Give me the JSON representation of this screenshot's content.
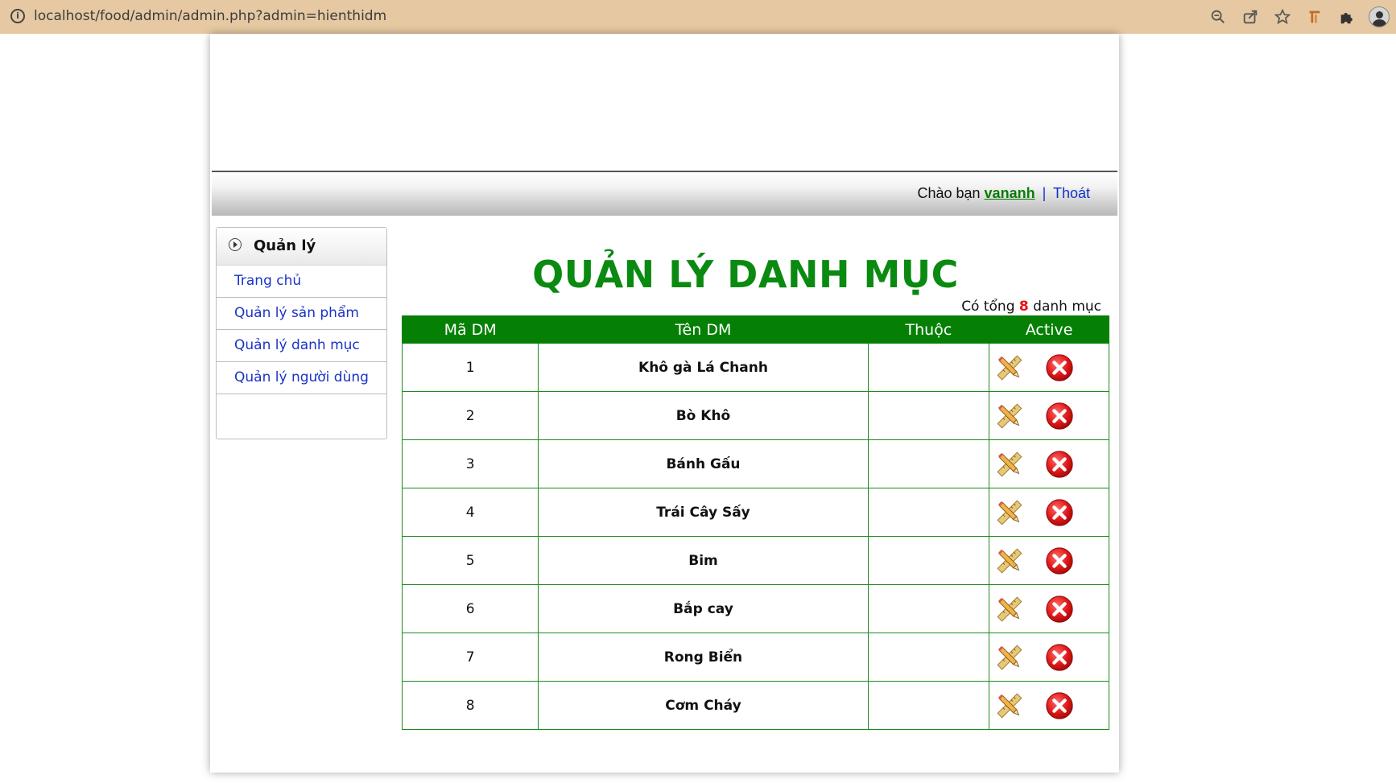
{
  "browser": {
    "url": "localhost/food/admin/admin.php?admin=hienthidm"
  },
  "userbar": {
    "greeting": "Chào bạn",
    "username": "vananh",
    "separator": "|",
    "logout_label": "Thoát"
  },
  "sidebar": {
    "title": "Quản lý",
    "items": [
      {
        "label": "Trang chủ"
      },
      {
        "label": "Quản lý sản phẩm"
      },
      {
        "label": "Quản lý danh mục"
      },
      {
        "label": "Quản lý người dùng"
      }
    ]
  },
  "main": {
    "title": "QUẢN LÝ DANH MỤC",
    "count_prefix": "Có tổng",
    "count_value": "8",
    "count_suffix": "danh mục",
    "table": {
      "headers": [
        "Mã DM",
        "Tên DM",
        "Thuộc",
        "Active"
      ],
      "rows": [
        {
          "id": "1",
          "name": "Khô gà Lá Chanh",
          "parent": ""
        },
        {
          "id": "2",
          "name": "Bò Khô",
          "parent": ""
        },
        {
          "id": "3",
          "name": "Bánh Gấu",
          "parent": ""
        },
        {
          "id": "4",
          "name": "Trái Cây Sấy",
          "parent": ""
        },
        {
          "id": "5",
          "name": "Bim",
          "parent": ""
        },
        {
          "id": "6",
          "name": "Bắp cay",
          "parent": ""
        },
        {
          "id": "7",
          "name": "Rong Biển",
          "parent": ""
        },
        {
          "id": "8",
          "name": "Cơm Cháy",
          "parent": ""
        }
      ]
    },
    "row_actions": {
      "edit_icon": "pencil-ruler-icon",
      "delete_icon": "red-x-circle-icon"
    }
  },
  "colors": {
    "chrome_bg": "#e6c9a2",
    "accent_green": "#058005",
    "title_green": "#0a8a10",
    "link_blue": "#1a33c8",
    "count_red": "#e81414"
  }
}
